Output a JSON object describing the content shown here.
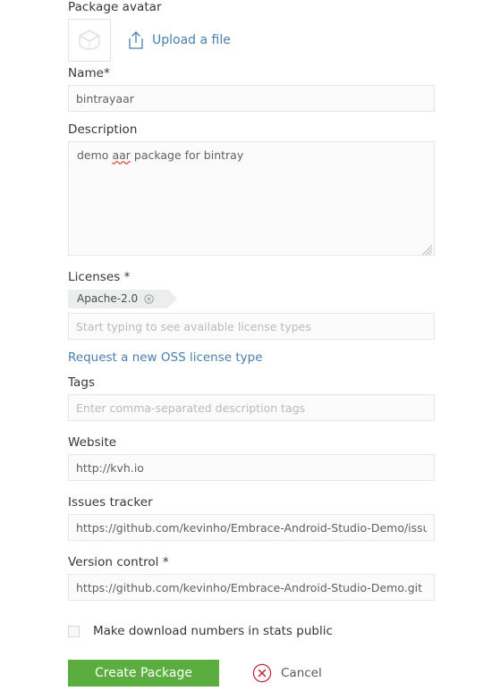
{
  "form": {
    "avatar": {
      "label": "Package avatar",
      "icon": "package-cube-icon",
      "upload_icon": "upload-icon",
      "upload_label": "Upload a file"
    },
    "name": {
      "label": "Name*",
      "value": "bintrayaar",
      "placeholder": ""
    },
    "description": {
      "label": "Description",
      "value": "demo aar package for bintray",
      "misspelled_word": "aar",
      "value_before": "demo ",
      "value_after": " package for bintray",
      "placeholder": ""
    },
    "licenses": {
      "label": "Licenses *",
      "chips": [
        {
          "label": "Apache-2.0",
          "remove_icon": "remove-circle-icon"
        }
      ],
      "placeholder": "Start typing to see available license types",
      "value": "",
      "request_link": "Request a new OSS license type"
    },
    "tags": {
      "label": "Tags",
      "placeholder": "Enter comma-separated description tags",
      "value": ""
    },
    "website": {
      "label": "Website",
      "value": "http://kvh.io",
      "placeholder": ""
    },
    "issues_tracker": {
      "label": "Issues tracker",
      "value": "https://github.com/kevinho/Embrace-Android-Studio-Demo/issues",
      "placeholder": ""
    },
    "version_control": {
      "label": "Version control *",
      "value": "https://github.com/kevinho/Embrace-Android-Studio-Demo.git",
      "placeholder": ""
    },
    "stats_public": {
      "label": "Make download numbers in stats public",
      "checked": false
    },
    "actions": {
      "submit_label": "Create Package",
      "cancel_label": "Cancel",
      "cancel_icon": "cancel-circle-x-icon"
    }
  },
  "colors": {
    "primary_button": "#5cad3f",
    "link": "#4a7fad",
    "cancel_red": "#c52033",
    "label_text": "#33373b",
    "input_text": "#5d6267",
    "placeholder_text": "#b6bbbf",
    "input_border": "#e4e6e8",
    "input_background": "#fbfbfc",
    "chip_background": "#eceded",
    "spellcheck_underline": "#e04a3f",
    "page_background": "#ffffff"
  }
}
